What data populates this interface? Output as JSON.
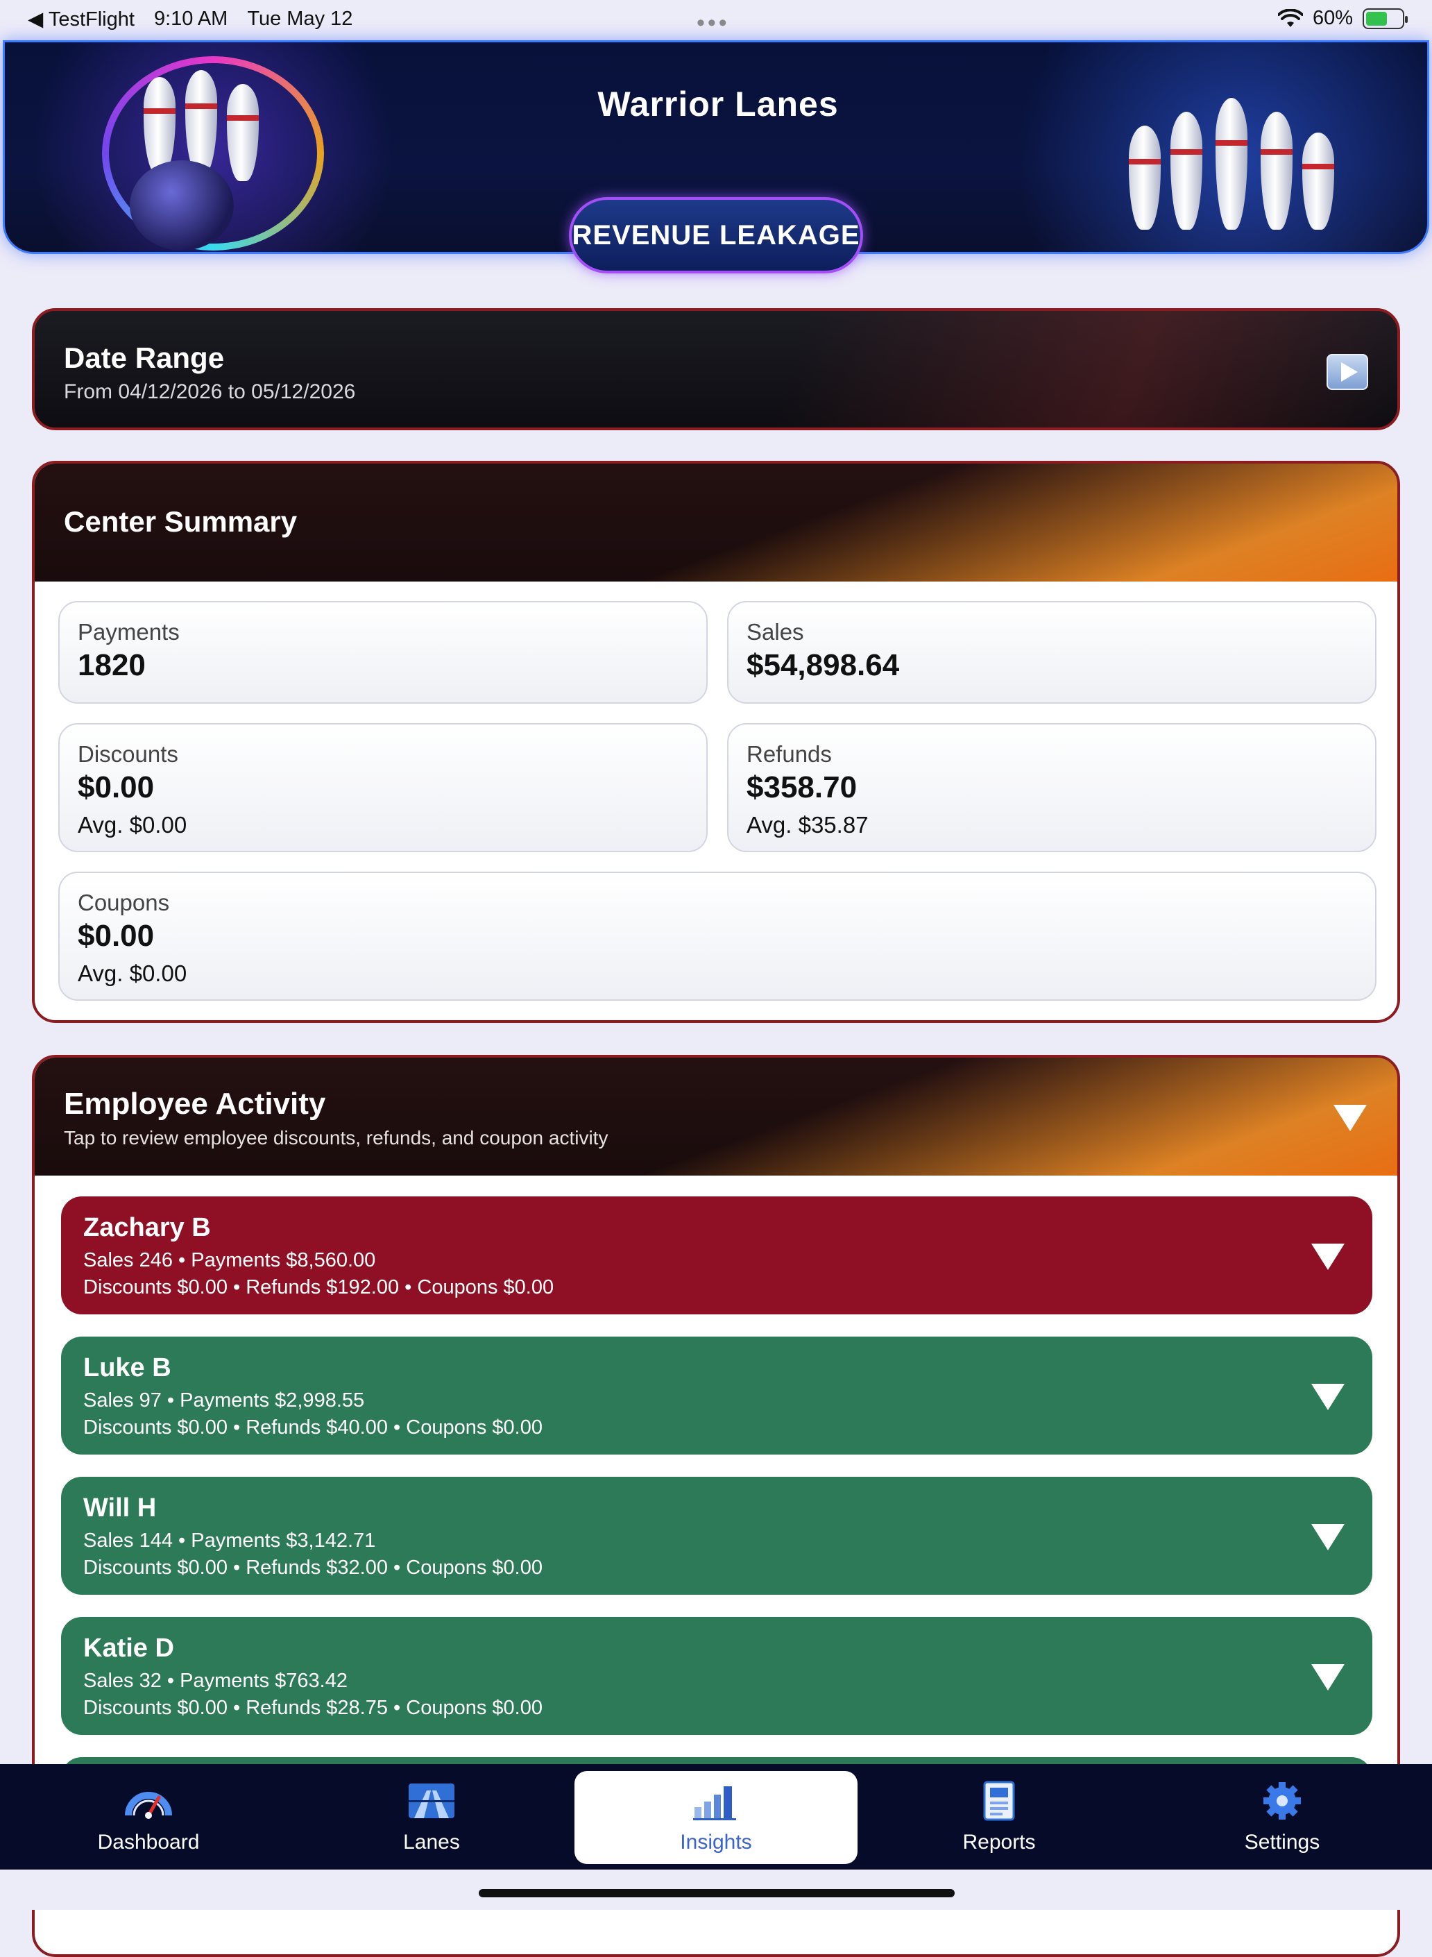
{
  "status_bar": {
    "back_app": "◀ TestFlight",
    "time": "9:10 AM",
    "date": "Tue May 12",
    "battery": "60%",
    "battery_level": 0.6,
    "dots": "•••"
  },
  "banner": {
    "title": "Warrior Lanes",
    "button_label": "REVENUE LEAKAGE"
  },
  "date_range": {
    "title": "Date Range",
    "subtitle": "From 04/12/2026 to 05/12/2026"
  },
  "summary": {
    "title": "Center Summary",
    "payments": {
      "label": "Payments",
      "value": "1820"
    },
    "sales": {
      "label": "Sales",
      "value": "$54,898.64"
    },
    "discounts": {
      "label": "Discounts",
      "value": "$0.00",
      "avg": "Avg. $0.00"
    },
    "refunds": {
      "label": "Refunds",
      "value": "$358.70",
      "avg": "Avg. $35.87"
    },
    "coupons": {
      "label": "Coupons",
      "value": "$0.00",
      "avg": "Avg. $0.00"
    }
  },
  "employees": {
    "title": "Employee Activity",
    "subtitle": "Tap to review employee discounts, refunds, and coupon activity",
    "items": [
      {
        "name": "Zachary B",
        "line1": "Sales 246 • Payments $8,560.00",
        "line2": "Discounts $0.00 • Refunds $192.00 • Coupons $0.00",
        "status": "red"
      },
      {
        "name": "Luke B",
        "line1": "Sales 97 • Payments $2,998.55",
        "line2": "Discounts $0.00 • Refunds $40.00 • Coupons $0.00",
        "status": "green"
      },
      {
        "name": "Will H",
        "line1": "Sales 144 • Payments $3,142.71",
        "line2": "Discounts $0.00 • Refunds $32.00 • Coupons $0.00",
        "status": "green"
      },
      {
        "name": "Katie D",
        "line1": "Sales 32 • Payments $763.42",
        "line2": "Discounts $0.00 • Refunds $28.75 • Coupons $0.00",
        "status": "green"
      }
    ]
  },
  "tabs": [
    {
      "label": "Dashboard",
      "icon": "speedometer-icon"
    },
    {
      "label": "Lanes",
      "icon": "lanes-icon"
    },
    {
      "label": "Insights",
      "icon": "bar-chart-icon",
      "active": true
    },
    {
      "label": "Reports",
      "icon": "report-icon"
    },
    {
      "label": "Settings",
      "icon": "gear-icon"
    }
  ],
  "colors": {
    "accent_red": "#8f1024",
    "accent_green": "#2d7a58",
    "tabbar_bg": "#060b2a",
    "active_tab_text": "#3a64c9"
  }
}
